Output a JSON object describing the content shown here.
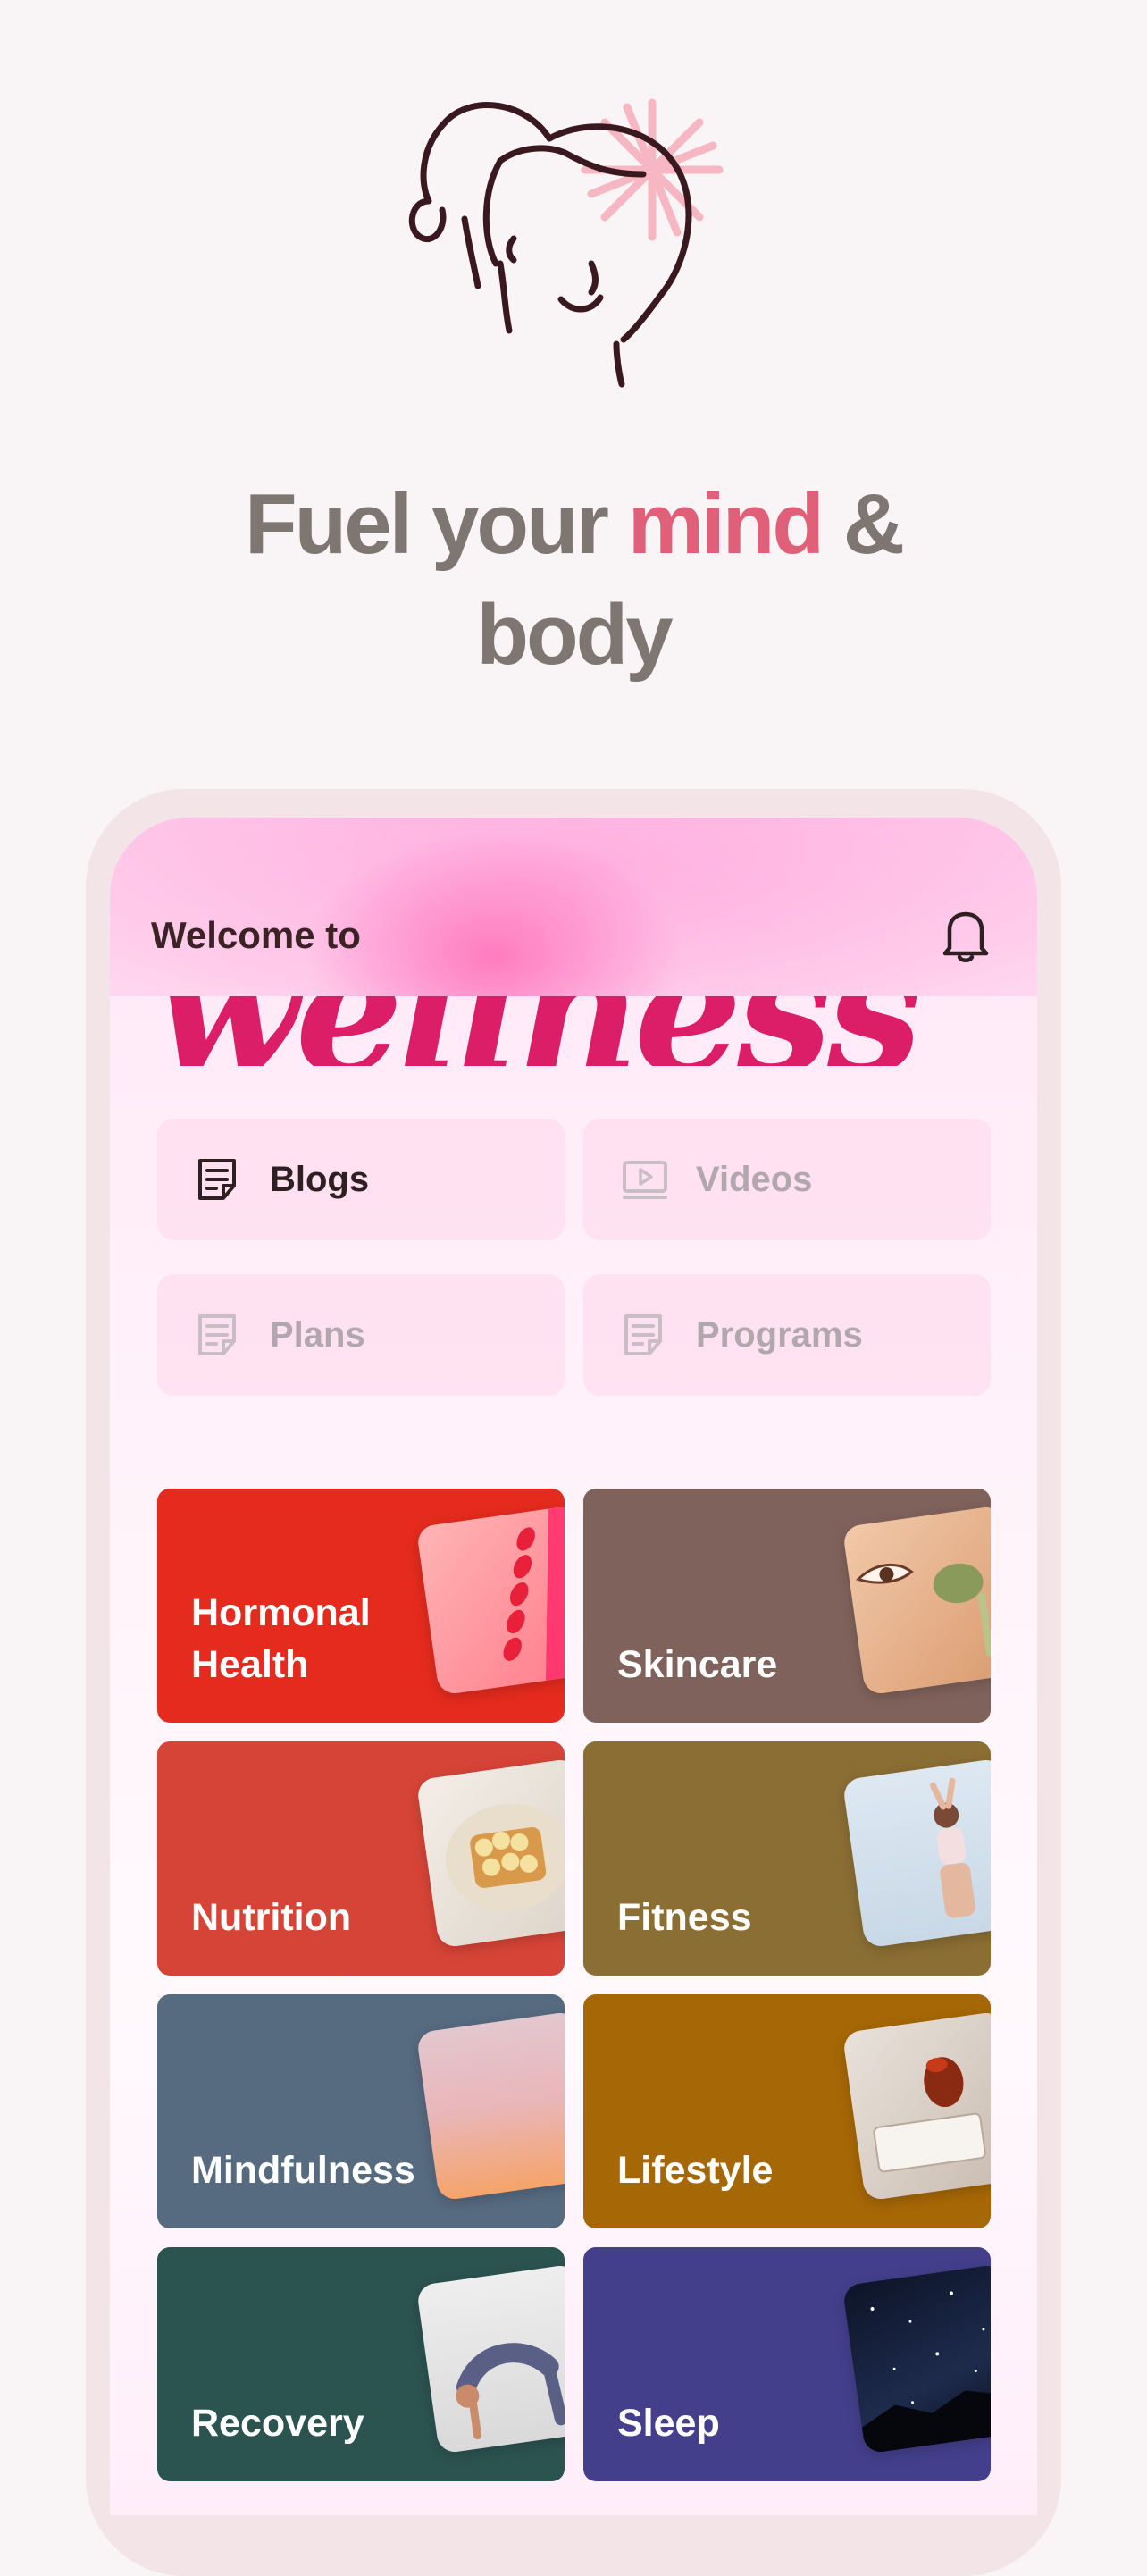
{
  "headline": {
    "part1": "Fuel your ",
    "accent": "mind",
    "part2": " &",
    "line2": "body"
  },
  "colors": {
    "accent": "#e0607a",
    "brand": "#dc1d68",
    "background": "#f9f4f5"
  },
  "app": {
    "welcome_text": "Welcome to",
    "brand_name": "wellness",
    "bell_icon": "bell-icon"
  },
  "tabs": [
    {
      "label": "Blogs",
      "icon": "document-icon",
      "active": true
    },
    {
      "label": "Videos",
      "icon": "video-icon",
      "active": false
    },
    {
      "label": "Plans",
      "icon": "document-icon",
      "active": false
    },
    {
      "label": "Programs",
      "icon": "document-icon",
      "active": false
    }
  ],
  "categories": [
    {
      "label": "Hormonal Health",
      "color": "#e42b1e"
    },
    {
      "label": "Skincare",
      "color": "#7f625b"
    },
    {
      "label": "Nutrition",
      "color": "#d64437"
    },
    {
      "label": "Fitness",
      "color": "#8b6e33"
    },
    {
      "label": "Mindfulness",
      "color": "#566a80"
    },
    {
      "label": "Lifestyle",
      "color": "#a66706"
    },
    {
      "label": "Recovery",
      "color": "#2b5350"
    },
    {
      "label": "Sleep",
      "color": "#433f8b"
    }
  ]
}
